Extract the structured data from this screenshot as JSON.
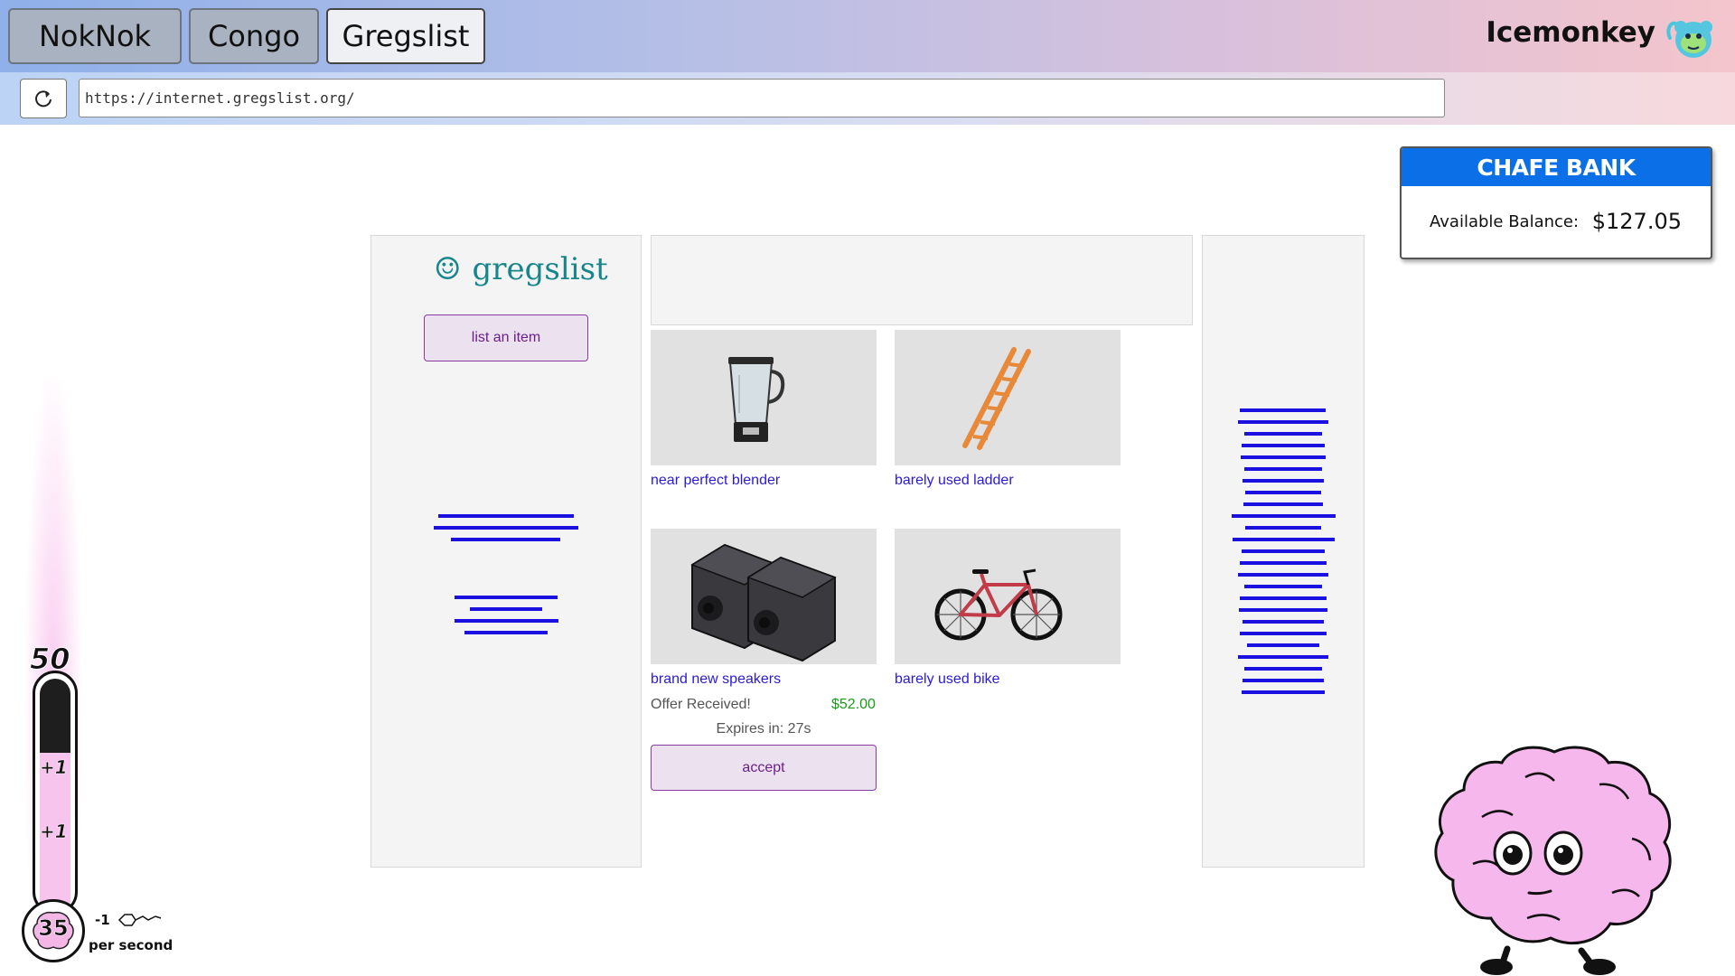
{
  "tabs": [
    {
      "label": "NokNok",
      "active": false
    },
    {
      "label": "Congo",
      "active": false
    },
    {
      "label": "Gregslist",
      "active": true
    }
  ],
  "brand": {
    "name": "Icemonkey",
    "icon": "monkey-icon"
  },
  "browser": {
    "url": "https://internet.gregslist.org/",
    "reload_icon": "reload-icon"
  },
  "bank": {
    "title": "CHAFE BANK",
    "balance_label": "Available Balance:",
    "balance": "$127.05"
  },
  "gregslist": {
    "logo_icon": "☺",
    "logo_text": "gregslist",
    "list_button": "list an item",
    "items": [
      {
        "title": "near perfect blender",
        "icon": "blender-icon"
      },
      {
        "title": "barely used ladder",
        "icon": "ladder-icon"
      },
      {
        "title": "brand new speakers",
        "icon": "speakers-icon"
      },
      {
        "title": "barely used bike",
        "icon": "bike-icon"
      }
    ],
    "offer": {
      "label": "Offer Received!",
      "price": "$52.00",
      "expires": "Expires in: 27s",
      "accept": "accept"
    }
  },
  "dopamine": {
    "max": "50",
    "value": "35",
    "plus_labels": [
      "+1",
      "+1"
    ],
    "rate": "-1",
    "rate_label": "per second",
    "molecule_icon": "dopamine-molecule-icon"
  },
  "colors": {
    "accent": "#0b6fe8",
    "link": "#2a1ad8",
    "button_border": "#8a3aa0",
    "price": "#1a9a1a"
  }
}
